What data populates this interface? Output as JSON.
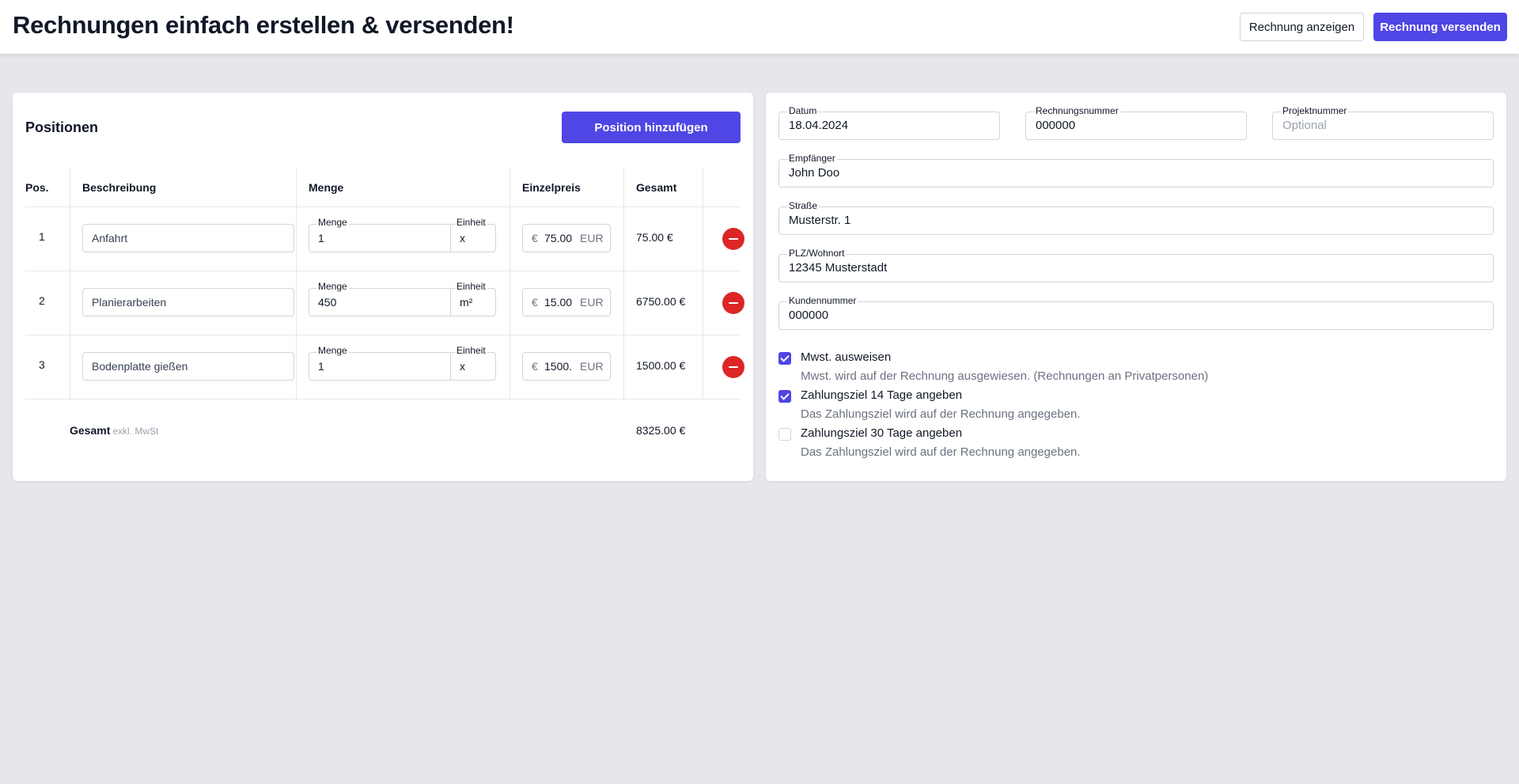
{
  "header": {
    "title": "Rechnungen einfach erstellen & versenden!",
    "show_invoice": "Rechnung anzeigen",
    "send_invoice": "Rechnung versenden"
  },
  "positions": {
    "title": "Positionen",
    "add_button": "Position hinzufügen",
    "columns": {
      "pos": "Pos.",
      "description": "Beschreibung",
      "quantity": "Menge",
      "unit_price": "Einzelpreis",
      "total": "Gesamt"
    },
    "field_labels": {
      "quantity": "Menge",
      "unit": "Einheit",
      "currency_symbol": "€",
      "currency_code": "EUR"
    },
    "rows": [
      {
        "pos": "1",
        "description": "Anfahrt",
        "quantity": "1",
        "unit": "x",
        "price": "75.00",
        "total": "75.00 €"
      },
      {
        "pos": "2",
        "description": "Planierarbeiten",
        "quantity": "450",
        "unit": "m²",
        "price": "15.00",
        "total": "6750.00 €"
      },
      {
        "pos": "3",
        "description": "Bodenplatte gießen",
        "quantity": "1",
        "unit": "x",
        "price": "1500.",
        "total": "1500.00 €"
      }
    ],
    "sum_label": "Gesamt",
    "sum_sublabel": "exkl. MwSt",
    "sum_value": "8325.00 €"
  },
  "details": {
    "date_label": "Datum",
    "date_value": "18.04.2024",
    "invoice_no_label": "Rechnungsnummer",
    "invoice_no_value": "000000",
    "project_no_label": "Projektnummer",
    "project_no_placeholder": "Optional",
    "recipient_label": "Empfänger",
    "recipient_value": "John Doo",
    "street_label": "Straße",
    "street_value": "Musterstr. 1",
    "zip_city_label": "PLZ/Wohnort",
    "zip_city_value": "12345 Musterstadt",
    "customer_no_label": "Kundennummer",
    "customer_no_value": "000000"
  },
  "options": [
    {
      "title": "Mwst. ausweisen",
      "description": "Mwst. wird auf der Rechnung ausgewiesen. (Rechnungen an Privatpersonen)",
      "checked": true
    },
    {
      "title": "Zahlungsziel 14 Tage angeben",
      "description": "Das Zahlungsziel wird auf der Rechnung angegeben.",
      "checked": true
    },
    {
      "title": "Zahlungsziel 30 Tage angeben",
      "description": "Das Zahlungsziel wird auf der Rechnung angegeben.",
      "checked": false
    }
  ],
  "colors": {
    "accent": "#4f46e5",
    "danger": "#dc2626",
    "background": "#e5e7eb"
  }
}
